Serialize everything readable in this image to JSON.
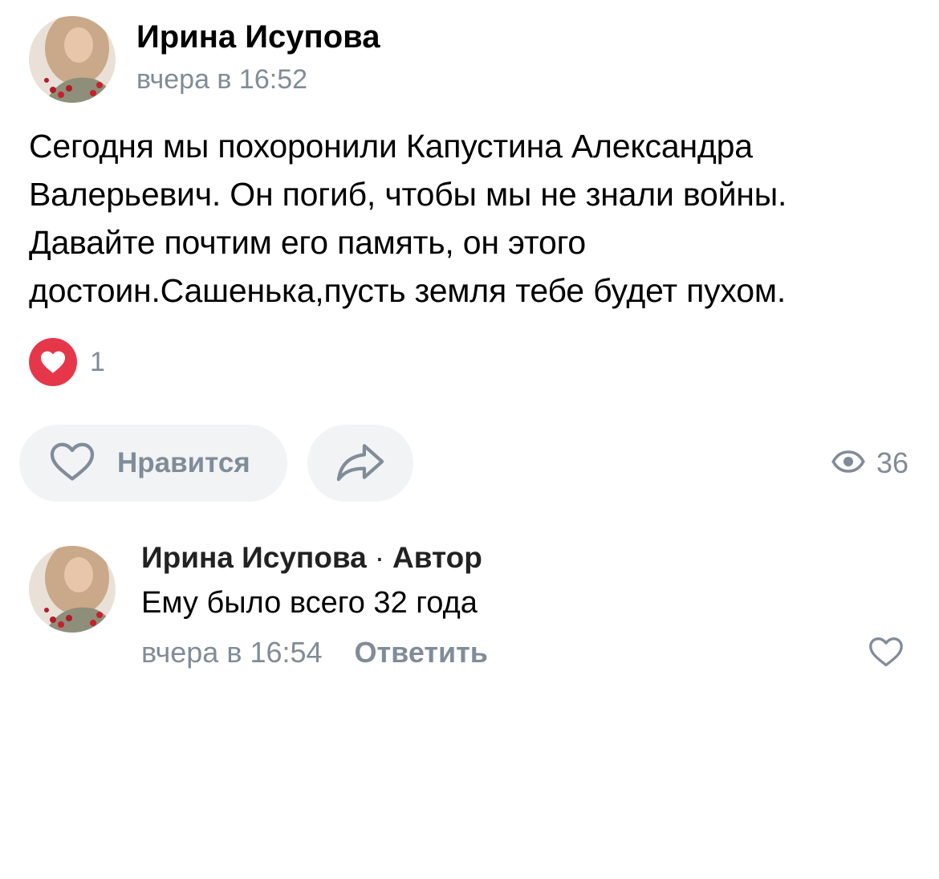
{
  "post": {
    "author": "Ирина Исупова",
    "time": "вчера в 16:52",
    "text_lines": [
      "Сегодня мы похоронили Капустина Александра",
      "Валерьевич. Он погиб, чтобы мы не знали войны.",
      "Давайте почтим его память, он этого",
      "достоин.Сашенька,пусть земля тебе будет пухом."
    ],
    "reaction_icon": "heart-filled-icon",
    "reaction_count": "1"
  },
  "actions": {
    "like_label": "Нравится",
    "like_icon": "heart-outline-icon",
    "share_icon": "share-arrow-icon",
    "views_icon": "eye-icon",
    "views_count": "36"
  },
  "comment": {
    "author": "Ирина Исупова",
    "separator": "·",
    "badge": "Автор",
    "text": "Ему было всего 32 года",
    "time": "вчера в 16:54",
    "reply_label": "Ответить",
    "like_icon": "heart-outline-icon"
  },
  "colors": {
    "secondary_text": "#818c99",
    "reaction_red": "#e6374a",
    "button_bg": "#f2f3f5"
  }
}
